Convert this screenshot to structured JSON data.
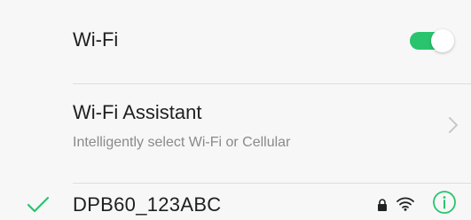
{
  "wifi": {
    "label": "Wi-Fi",
    "enabled": true,
    "toggle_color": "#29c46d"
  },
  "assistant": {
    "title": "Wi-Fi Assistant",
    "subtitle": "Intelligently select Wi-Fi or Cellular",
    "icon": "chevron-right-icon"
  },
  "network": {
    "name": "DPB60_123ABC",
    "connected": true,
    "secured": true,
    "status_icon": "checkmark-icon",
    "accent_color": "#29c46d",
    "icons": [
      "lock-icon",
      "wifi-signal-icon",
      "info-icon"
    ]
  }
}
